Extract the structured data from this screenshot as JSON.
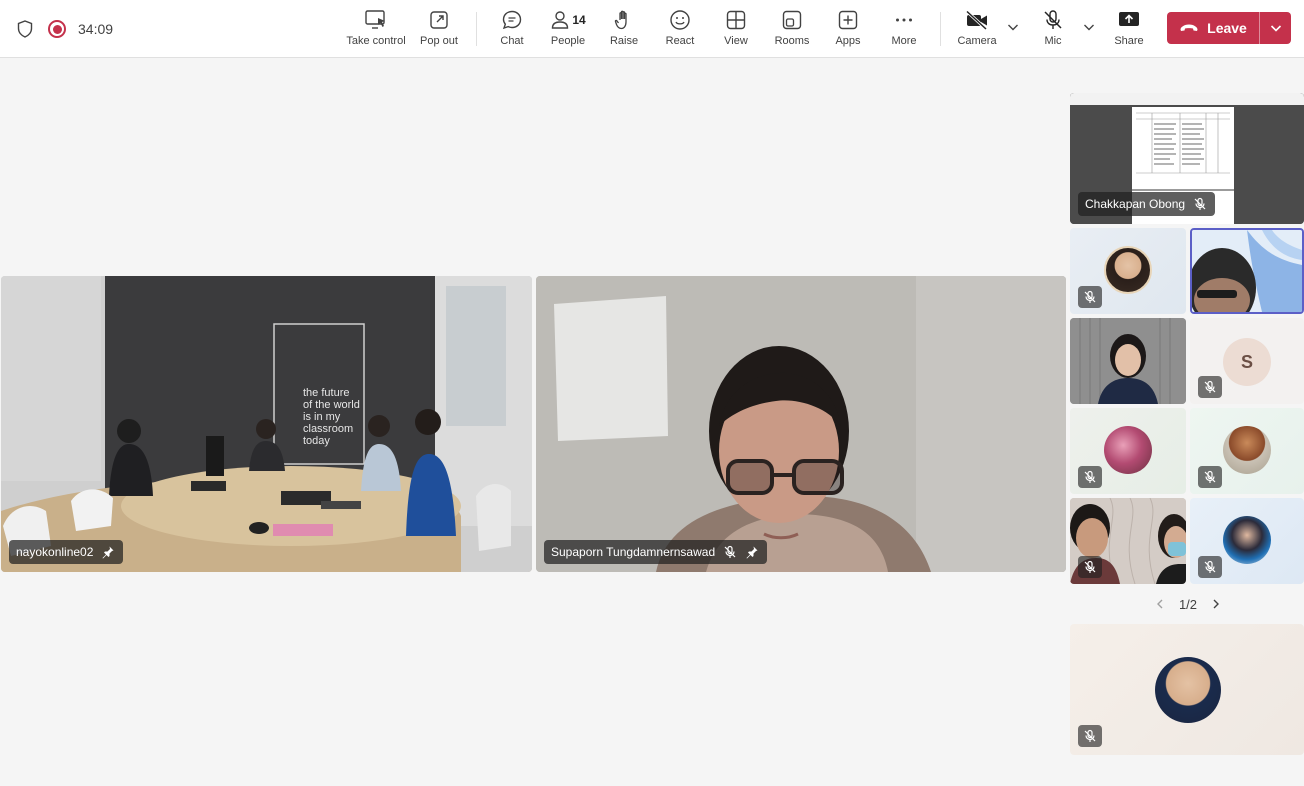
{
  "meeting": {
    "timer": "34:09",
    "toolbar": {
      "take_control": "Take control",
      "pop_out": "Pop out",
      "chat": "Chat",
      "people": "People",
      "people_count": "14",
      "raise": "Raise",
      "react": "React",
      "view": "View",
      "rooms": "Rooms",
      "apps": "Apps",
      "more": "More",
      "camera": "Camera",
      "mic": "Mic",
      "share": "Share",
      "leave": "Leave"
    }
  },
  "stage": {
    "tiles": [
      {
        "name": "nayokonline02",
        "pinned": true,
        "muted": false,
        "room_sign": "the future\nof the world\nis in my\nclassroom\ntoday"
      },
      {
        "name": "Supaporn Tungdamnernsawad",
        "pinned": true,
        "muted": true
      }
    ]
  },
  "side_panel": {
    "screen_share_name": "Chakkapan Obong",
    "participants": [
      {
        "kind": "avatar",
        "muted": true
      },
      {
        "kind": "video",
        "muted": false,
        "speaking": true
      },
      {
        "kind": "video",
        "muted": false
      },
      {
        "kind": "initial",
        "initial": "S",
        "muted": true
      },
      {
        "kind": "avatar",
        "muted": true
      },
      {
        "kind": "avatar",
        "muted": true
      },
      {
        "kind": "video",
        "muted": true
      },
      {
        "kind": "avatar",
        "muted": true
      }
    ],
    "pager": "1/2",
    "bottom_tile": {
      "kind": "avatar",
      "muted": true
    }
  }
}
